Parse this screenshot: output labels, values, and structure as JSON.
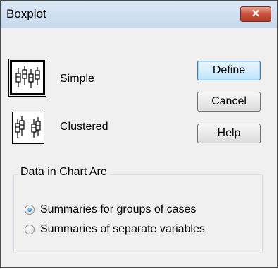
{
  "window": {
    "title": "Boxplot",
    "close_label": "✕"
  },
  "chart_types": [
    {
      "label": "Simple",
      "selected": true,
      "icon": "simple-boxplot-icon"
    },
    {
      "label": "Clustered",
      "selected": false,
      "icon": "clustered-boxplot-icon"
    }
  ],
  "buttons": {
    "define": "Define",
    "cancel": "Cancel",
    "help": "Help"
  },
  "data_group": {
    "legend": "Data in Chart Are",
    "options": [
      {
        "label": "Summaries for groups of cases",
        "checked": true
      },
      {
        "label": "Summaries of separate variables",
        "checked": false
      }
    ]
  },
  "colors": {
    "titlebar": "#c8daee",
    "close_button": "#c8523a",
    "dialog_bg": "#f0f0f0",
    "default_button": "#bee6fd",
    "radio_selected": "#1b6ec2"
  }
}
